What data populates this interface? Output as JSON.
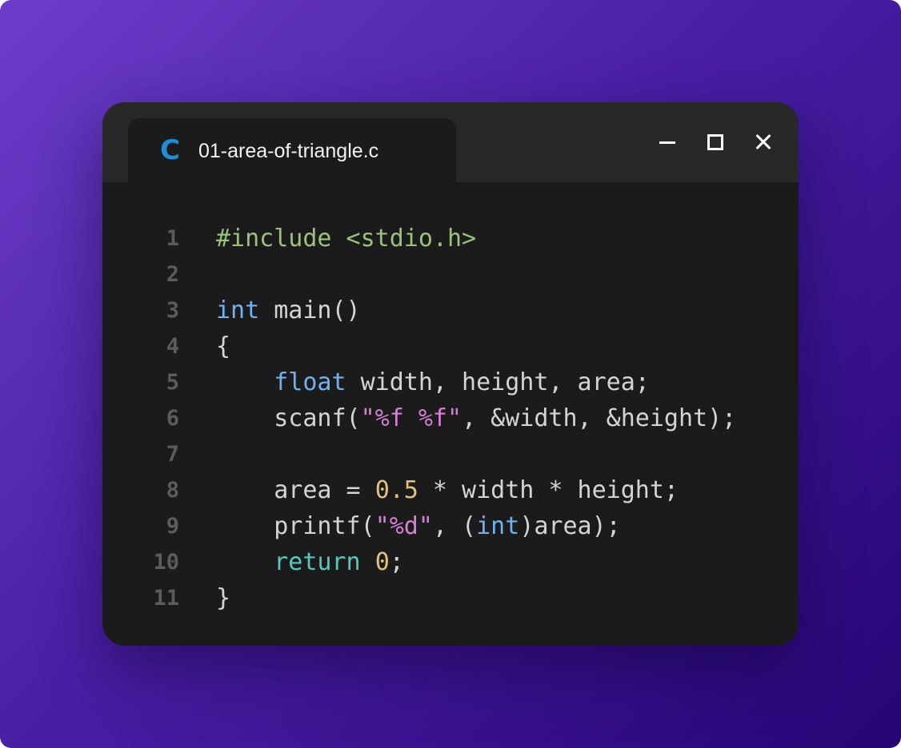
{
  "window": {
    "tab_icon_letter": "C",
    "file_name": "01-area-of-triangle.c",
    "controls": {
      "minimize": "minimize-icon",
      "maximize": "maximize-icon",
      "close": "close-icon"
    }
  },
  "colors": {
    "background_gradient": [
      "#6c3dc9",
      "#260575"
    ],
    "window_bg": "#1b1b1b",
    "titlebar_bg": "#282828",
    "c_icon": "#1e8fd6",
    "directive": "#98c379",
    "keyword": "#6fb2f0",
    "return_keyword": "#56c7c1",
    "string": "#d67fd6",
    "number": "#e5c07b",
    "plain": "#d4d4d4",
    "line_number": "#5c5c5c"
  },
  "editor": {
    "lines": [
      {
        "number": "1",
        "tokens": [
          {
            "text": "#include <stdio.h>",
            "type": "directive"
          }
        ]
      },
      {
        "number": "2",
        "tokens": []
      },
      {
        "number": "3",
        "tokens": [
          {
            "text": "int",
            "type": "keyword"
          },
          {
            "text": " main()",
            "type": "plain"
          }
        ]
      },
      {
        "number": "4",
        "tokens": [
          {
            "text": "{",
            "type": "plain"
          }
        ]
      },
      {
        "number": "5",
        "tokens": [
          {
            "text": "    ",
            "type": "plain"
          },
          {
            "text": "float",
            "type": "keyword"
          },
          {
            "text": " width, height, area;",
            "type": "plain"
          }
        ]
      },
      {
        "number": "6",
        "tokens": [
          {
            "text": "    scanf(",
            "type": "plain"
          },
          {
            "text": "\"%f %f\"",
            "type": "string"
          },
          {
            "text": ", &width, &height);",
            "type": "plain"
          }
        ]
      },
      {
        "number": "7",
        "tokens": []
      },
      {
        "number": "8",
        "tokens": [
          {
            "text": "    area = ",
            "type": "plain"
          },
          {
            "text": "0.5",
            "type": "number"
          },
          {
            "text": " * width * height;",
            "type": "plain"
          }
        ]
      },
      {
        "number": "9",
        "tokens": [
          {
            "text": "    printf(",
            "type": "plain"
          },
          {
            "text": "\"%d\"",
            "type": "string"
          },
          {
            "text": ", (",
            "type": "plain"
          },
          {
            "text": "int",
            "type": "keyword"
          },
          {
            "text": ")area);",
            "type": "plain"
          }
        ]
      },
      {
        "number": "10",
        "tokens": [
          {
            "text": "    ",
            "type": "plain"
          },
          {
            "text": "return",
            "type": "return"
          },
          {
            "text": " ",
            "type": "plain"
          },
          {
            "text": "0",
            "type": "number"
          },
          {
            "text": ";",
            "type": "plain"
          }
        ]
      },
      {
        "number": "11",
        "tokens": [
          {
            "text": "}",
            "type": "plain"
          }
        ]
      }
    ]
  }
}
